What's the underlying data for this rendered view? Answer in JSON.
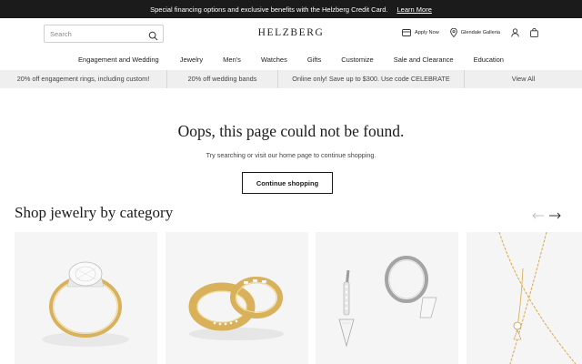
{
  "promo": {
    "text": "Special financing options and exclusive benefits with the Helzberg Credit Card.",
    "link": "Learn More"
  },
  "header": {
    "search_placeholder": "Search",
    "logo": "HELZBERG",
    "apply_now": "Apply Now",
    "store": "Glendale Galleria"
  },
  "nav": [
    "Engagement and Wedding",
    "Jewelry",
    "Men's",
    "Watches",
    "Gifts",
    "Customize",
    "Sale and Clearance",
    "Education"
  ],
  "offers": [
    "20% off engagement rings, including custom!",
    "20% off wedding bands",
    "Online only! Save up to $300. Use code CELEBRATE",
    "View All"
  ],
  "error": {
    "title": "Oops, this page could not be found.",
    "subtitle": "Try searching or visit our home page to continue shopping.",
    "cta": "Continue shopping"
  },
  "category": {
    "title": "Shop jewelry by category",
    "cards": [
      {
        "image": "engagement-ring-image"
      },
      {
        "image": "wedding-bands-image"
      },
      {
        "image": "earrings-image"
      },
      {
        "image": "necklace-image"
      }
    ]
  },
  "icons": {
    "search": "search-icon",
    "card": "credit-card-icon",
    "location": "location-pin-icon",
    "account": "user-icon",
    "bag": "shopping-bag-icon",
    "prev": "arrow-left-icon",
    "next": "arrow-right-icon"
  },
  "colors": {
    "promo_bg": "#1b1b1b",
    "offers_bg": "#efefef",
    "gold": "#d8b15a"
  }
}
